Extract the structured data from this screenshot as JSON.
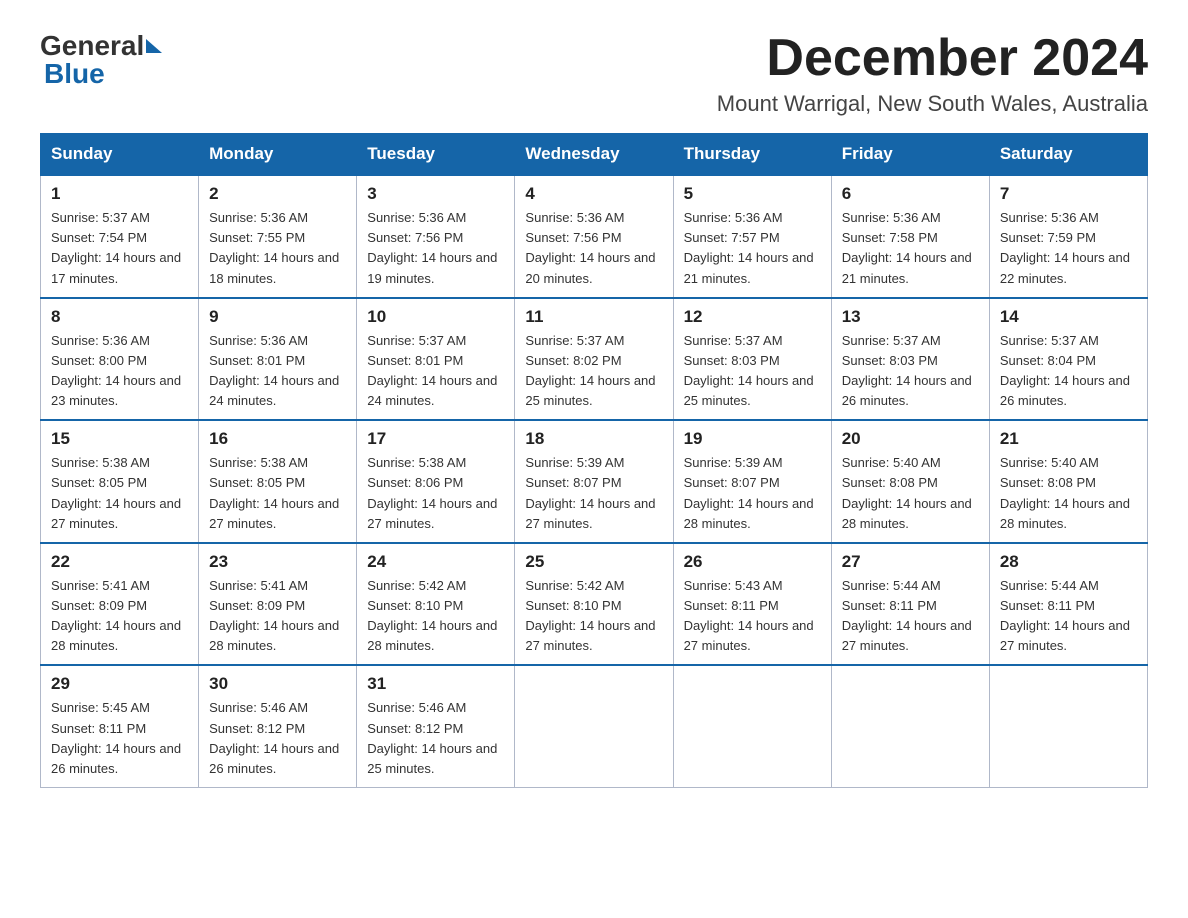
{
  "header": {
    "logo_general": "General",
    "logo_blue": "Blue",
    "month_title": "December 2024",
    "location": "Mount Warrigal, New South Wales, Australia"
  },
  "weekdays": [
    "Sunday",
    "Monday",
    "Tuesday",
    "Wednesday",
    "Thursday",
    "Friday",
    "Saturday"
  ],
  "weeks": [
    [
      {
        "day": "1",
        "sunrise": "5:37 AM",
        "sunset": "7:54 PM",
        "daylight": "14 hours and 17 minutes."
      },
      {
        "day": "2",
        "sunrise": "5:36 AM",
        "sunset": "7:55 PM",
        "daylight": "14 hours and 18 minutes."
      },
      {
        "day": "3",
        "sunrise": "5:36 AM",
        "sunset": "7:56 PM",
        "daylight": "14 hours and 19 minutes."
      },
      {
        "day": "4",
        "sunrise": "5:36 AM",
        "sunset": "7:56 PM",
        "daylight": "14 hours and 20 minutes."
      },
      {
        "day": "5",
        "sunrise": "5:36 AM",
        "sunset": "7:57 PM",
        "daylight": "14 hours and 21 minutes."
      },
      {
        "day": "6",
        "sunrise": "5:36 AM",
        "sunset": "7:58 PM",
        "daylight": "14 hours and 21 minutes."
      },
      {
        "day": "7",
        "sunrise": "5:36 AM",
        "sunset": "7:59 PM",
        "daylight": "14 hours and 22 minutes."
      }
    ],
    [
      {
        "day": "8",
        "sunrise": "5:36 AM",
        "sunset": "8:00 PM",
        "daylight": "14 hours and 23 minutes."
      },
      {
        "day": "9",
        "sunrise": "5:36 AM",
        "sunset": "8:01 PM",
        "daylight": "14 hours and 24 minutes."
      },
      {
        "day": "10",
        "sunrise": "5:37 AM",
        "sunset": "8:01 PM",
        "daylight": "14 hours and 24 minutes."
      },
      {
        "day": "11",
        "sunrise": "5:37 AM",
        "sunset": "8:02 PM",
        "daylight": "14 hours and 25 minutes."
      },
      {
        "day": "12",
        "sunrise": "5:37 AM",
        "sunset": "8:03 PM",
        "daylight": "14 hours and 25 minutes."
      },
      {
        "day": "13",
        "sunrise": "5:37 AM",
        "sunset": "8:03 PM",
        "daylight": "14 hours and 26 minutes."
      },
      {
        "day": "14",
        "sunrise": "5:37 AM",
        "sunset": "8:04 PM",
        "daylight": "14 hours and 26 minutes."
      }
    ],
    [
      {
        "day": "15",
        "sunrise": "5:38 AM",
        "sunset": "8:05 PM",
        "daylight": "14 hours and 27 minutes."
      },
      {
        "day": "16",
        "sunrise": "5:38 AM",
        "sunset": "8:05 PM",
        "daylight": "14 hours and 27 minutes."
      },
      {
        "day": "17",
        "sunrise": "5:38 AM",
        "sunset": "8:06 PM",
        "daylight": "14 hours and 27 minutes."
      },
      {
        "day": "18",
        "sunrise": "5:39 AM",
        "sunset": "8:07 PM",
        "daylight": "14 hours and 27 minutes."
      },
      {
        "day": "19",
        "sunrise": "5:39 AM",
        "sunset": "8:07 PM",
        "daylight": "14 hours and 28 minutes."
      },
      {
        "day": "20",
        "sunrise": "5:40 AM",
        "sunset": "8:08 PM",
        "daylight": "14 hours and 28 minutes."
      },
      {
        "day": "21",
        "sunrise": "5:40 AM",
        "sunset": "8:08 PM",
        "daylight": "14 hours and 28 minutes."
      }
    ],
    [
      {
        "day": "22",
        "sunrise": "5:41 AM",
        "sunset": "8:09 PM",
        "daylight": "14 hours and 28 minutes."
      },
      {
        "day": "23",
        "sunrise": "5:41 AM",
        "sunset": "8:09 PM",
        "daylight": "14 hours and 28 minutes."
      },
      {
        "day": "24",
        "sunrise": "5:42 AM",
        "sunset": "8:10 PM",
        "daylight": "14 hours and 28 minutes."
      },
      {
        "day": "25",
        "sunrise": "5:42 AM",
        "sunset": "8:10 PM",
        "daylight": "14 hours and 27 minutes."
      },
      {
        "day": "26",
        "sunrise": "5:43 AM",
        "sunset": "8:11 PM",
        "daylight": "14 hours and 27 minutes."
      },
      {
        "day": "27",
        "sunrise": "5:44 AM",
        "sunset": "8:11 PM",
        "daylight": "14 hours and 27 minutes."
      },
      {
        "day": "28",
        "sunrise": "5:44 AM",
        "sunset": "8:11 PM",
        "daylight": "14 hours and 27 minutes."
      }
    ],
    [
      {
        "day": "29",
        "sunrise": "5:45 AM",
        "sunset": "8:11 PM",
        "daylight": "14 hours and 26 minutes."
      },
      {
        "day": "30",
        "sunrise": "5:46 AM",
        "sunset": "8:12 PM",
        "daylight": "14 hours and 26 minutes."
      },
      {
        "day": "31",
        "sunrise": "5:46 AM",
        "sunset": "8:12 PM",
        "daylight": "14 hours and 25 minutes."
      },
      null,
      null,
      null,
      null
    ]
  ]
}
